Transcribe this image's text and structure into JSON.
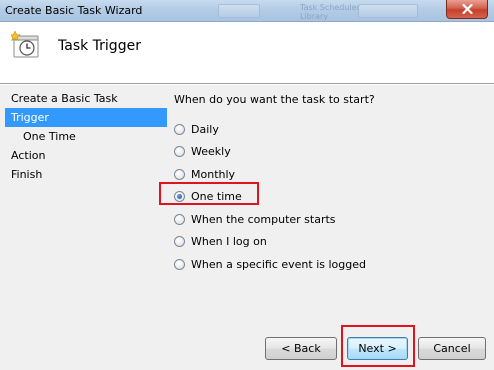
{
  "window": {
    "title": "Create Basic Task Wizard",
    "background_crumb": "Task Scheduler Library"
  },
  "header": {
    "title": "Task Trigger",
    "icon": "clock-task-icon"
  },
  "nav": {
    "items": [
      {
        "label": "Create a Basic Task",
        "selected": false,
        "sub": false
      },
      {
        "label": "Trigger",
        "selected": true,
        "sub": false
      },
      {
        "label": "One Time",
        "selected": false,
        "sub": true
      },
      {
        "label": "Action",
        "selected": false,
        "sub": false
      },
      {
        "label": "Finish",
        "selected": false,
        "sub": false
      }
    ]
  },
  "content": {
    "question": "When do you want the task to start?",
    "options": [
      {
        "label": "Daily",
        "checked": false
      },
      {
        "label": "Weekly",
        "checked": false
      },
      {
        "label": "Monthly",
        "checked": false
      },
      {
        "label": "One time",
        "checked": true
      },
      {
        "label": "When the computer starts",
        "checked": false
      },
      {
        "label": "When I log on",
        "checked": false
      },
      {
        "label": "When a specific event is logged",
        "checked": false
      }
    ]
  },
  "buttons": {
    "back": "< Back",
    "next": "Next >",
    "cancel": "Cancel"
  },
  "colors": {
    "highlight": "#e0141e",
    "selection": "#3399ff"
  }
}
